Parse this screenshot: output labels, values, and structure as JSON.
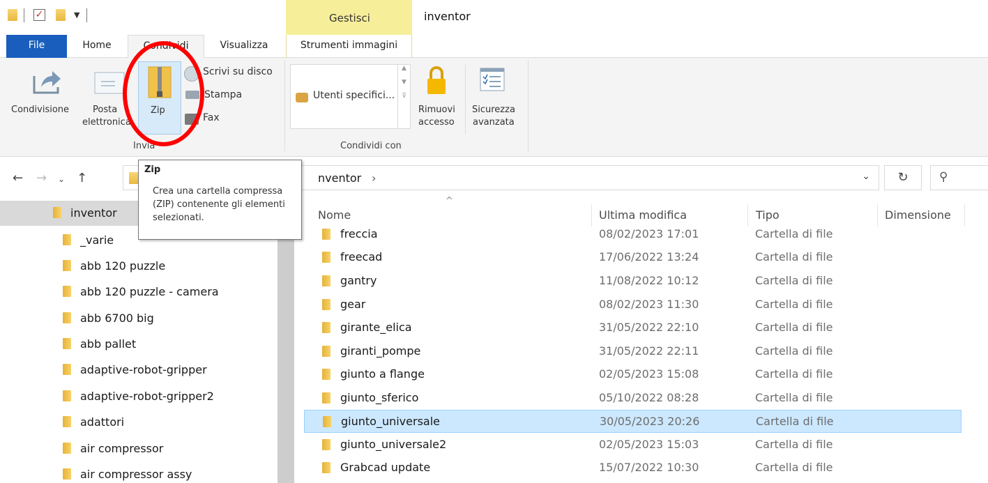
{
  "window": {
    "title": "inventor",
    "context_tab_group": "Gestisci"
  },
  "tabs": {
    "file": "File",
    "home": "Home",
    "condividi": "Condividi",
    "visualizza": "Visualizza",
    "strumenti": "Strumenti immagini"
  },
  "ribbon": {
    "condivisione": "Condivisione",
    "posta_line1": "Posta",
    "posta_line2": "elettronica",
    "zip": "Zip",
    "scrivi": "Scrivi su disco",
    "stampa": "Stampa",
    "fax": "Fax",
    "group_invia": "Invia",
    "utenti": "Utenti specifici...",
    "rimuovi_line1": "Rimuovi",
    "rimuovi_line2": "accesso",
    "sicurezza_line1": "Sicurezza",
    "sicurezza_line2": "avanzata",
    "group_condividi_con": "Condividi con"
  },
  "tooltip": {
    "title": "Zip",
    "text": "Crea una cartella compressa (ZIP) contenente gli elementi selezionati."
  },
  "address": {
    "path_tail": "nventor",
    "chevron": "›"
  },
  "tree": {
    "items": [
      {
        "label": "inventor"
      },
      {
        "label": "_varie"
      },
      {
        "label": "abb 120 puzzle"
      },
      {
        "label": "abb 120 puzzle - camera"
      },
      {
        "label": "abb 6700 big"
      },
      {
        "label": "abb pallet"
      },
      {
        "label": "adaptive-robot-gripper"
      },
      {
        "label": "adaptive-robot-gripper2"
      },
      {
        "label": "adattori"
      },
      {
        "label": "air compressor"
      },
      {
        "label": "air compressor assy"
      }
    ]
  },
  "list": {
    "columns": {
      "name": "Nome",
      "modified": "Ultima modifica",
      "type": "Tipo",
      "size": "Dimensione"
    },
    "rows": [
      {
        "name": "freccia",
        "date": "08/02/2023 17:01",
        "type": "Cartella di file"
      },
      {
        "name": "freecad",
        "date": "17/06/2022 13:24",
        "type": "Cartella di file"
      },
      {
        "name": "gantry",
        "date": "11/08/2022 10:12",
        "type": "Cartella di file"
      },
      {
        "name": "gear",
        "date": "08/02/2023 11:30",
        "type": "Cartella di file"
      },
      {
        "name": "girante_elica",
        "date": "31/05/2022 22:10",
        "type": "Cartella di file"
      },
      {
        "name": "giranti_pompe",
        "date": "31/05/2022 22:11",
        "type": "Cartella di file"
      },
      {
        "name": "giunto a flange",
        "date": "02/05/2023 15:08",
        "type": "Cartella di file"
      },
      {
        "name": "giunto_sferico",
        "date": "05/10/2022 08:28",
        "type": "Cartella di file"
      },
      {
        "name": "giunto_universale",
        "date": "30/05/2023 20:26",
        "type": "Cartella di file"
      },
      {
        "name": "giunto_universale2",
        "date": "02/05/2023 15:03",
        "type": "Cartella di file"
      },
      {
        "name": "Grabcad update",
        "date": "15/07/2022 10:30",
        "type": "Cartella di file"
      }
    ]
  },
  "colors": {
    "file_tab": "#1a5ebd",
    "gestisci_band": "#f7ee9a",
    "selection": "#cce8ff",
    "annotation_circle": "#ff0000"
  }
}
